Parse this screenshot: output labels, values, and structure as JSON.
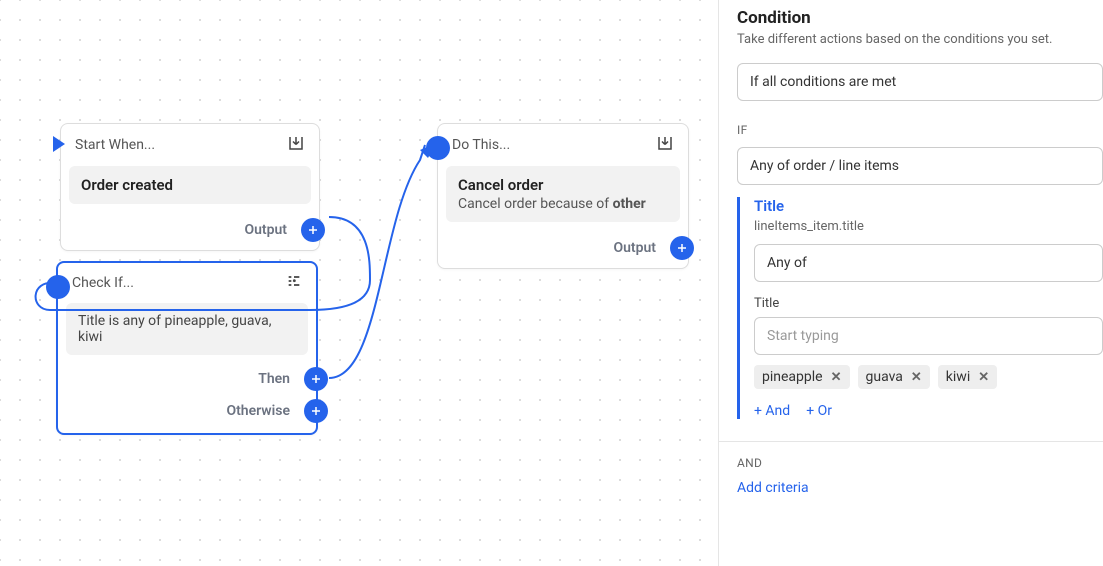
{
  "canvas": {
    "startNode": {
      "header": "Start When...",
      "body": "Order created",
      "outputLabel": "Output"
    },
    "checkNode": {
      "header": "Check If...",
      "body": "Title is any of pineapple, guava, kiwi",
      "thenLabel": "Then",
      "otherwiseLabel": "Otherwise"
    },
    "doNode": {
      "header": "Do This...",
      "title": "Cancel order",
      "subPrefix": "Cancel order because of ",
      "subBold": "other",
      "outputLabel": "Output"
    }
  },
  "panel": {
    "title": "Condition",
    "subtitle": "Take different actions based on the conditions you set.",
    "matchLabel": "If all conditions are met",
    "ifLabel": "IF",
    "ifSource": "Any of order / line items",
    "criteria": {
      "title": "Title",
      "path": "lineItems_item.title",
      "operator": "Any of",
      "fieldLabel": "Title",
      "placeholder": "Start typing",
      "tags": [
        "pineapple",
        "guava",
        "kiwi"
      ],
      "andLabel": "+ And",
      "orLabel": "+ Or"
    },
    "andLabel": "AND",
    "addCriteria": "Add criteria"
  }
}
